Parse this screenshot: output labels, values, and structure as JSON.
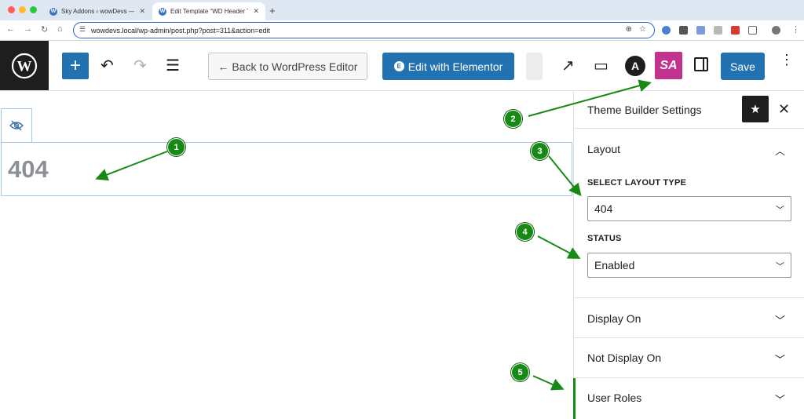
{
  "browser": {
    "tabs": [
      {
        "label": "Sky Addons ‹ wowDevs — W"
      },
      {
        "label": "Edit Template “WD Header Te"
      }
    ],
    "new_tab": "+",
    "url": "wowdevs.local/wp-admin/post.php?post=311&action=edit"
  },
  "toolbar": {
    "add_label": "+",
    "back_label": "← Back to WordPress Editor",
    "elementor_label": "Edit with Elementor",
    "astra_label": "A",
    "sky_label": "SA",
    "save_label": "Save",
    "more_label": "⋮"
  },
  "canvas": {
    "heading": "404"
  },
  "sidebar": {
    "title": "Theme Builder Settings",
    "layout_section": "Layout",
    "layout_type_label": "SELECT LAYOUT TYPE",
    "layout_type_value": "404",
    "status_label": "STATUS",
    "status_value": "Enabled",
    "display_on": "Display On",
    "not_display_on": "Not Display On",
    "user_roles": "User Roles"
  },
  "annotations": {
    "badge1": "1",
    "badge2": "2",
    "badge3": "3",
    "badge4": "4",
    "badge5": "5"
  },
  "colors": {
    "wp_blue": "#2271b1",
    "annotation_green": "#168a14",
    "sky_pink": "#c2338f"
  }
}
